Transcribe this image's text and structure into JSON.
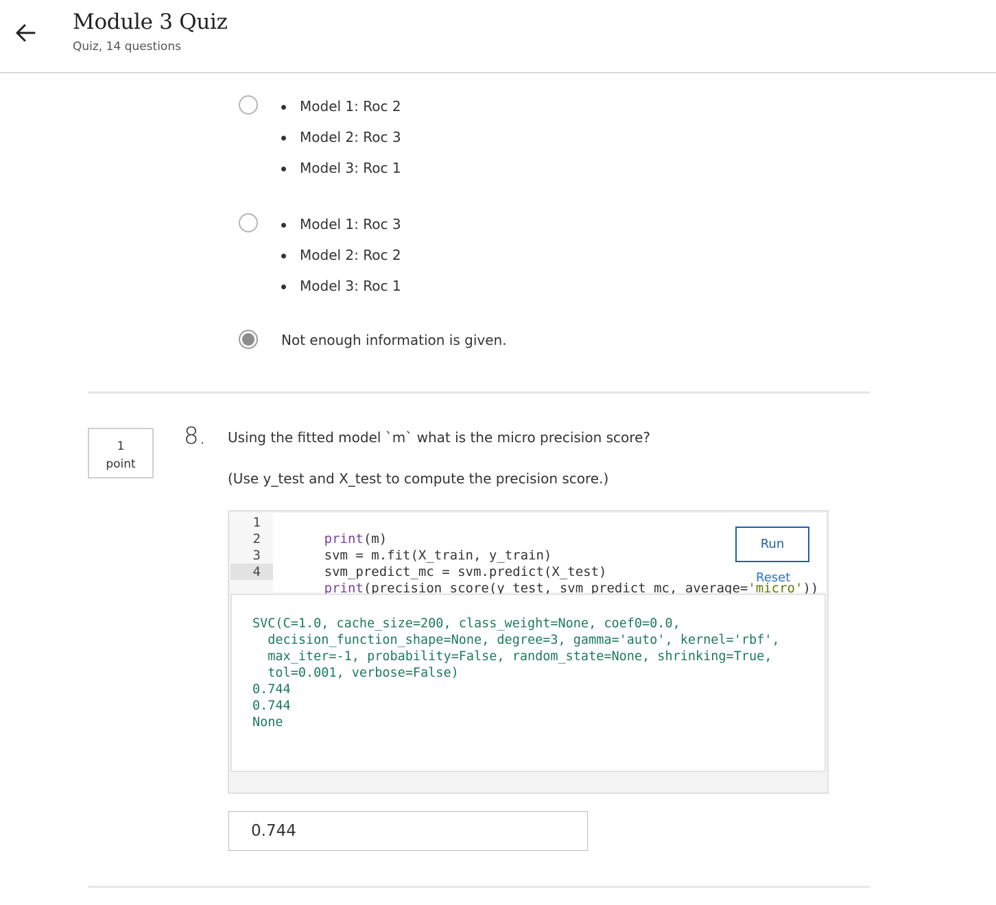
{
  "header": {
    "back_icon": "arrow-left-icon",
    "title": "Module 3 Quiz",
    "subtitle": "Quiz, 14 questions"
  },
  "previous_question": {
    "options": [
      {
        "items": [
          "Model 1: Roc 2",
          "Model 2: Roc 3",
          "Model 3: Roc 1"
        ],
        "selected": false
      },
      {
        "items": [
          "Model 1: Roc 3",
          "Model 2: Roc 2",
          "Model 3: Roc 1"
        ],
        "selected": false
      },
      {
        "text": "Not enough information is given.",
        "selected": true
      }
    ]
  },
  "question": {
    "points_value": "1",
    "points_label": "point",
    "number": "8.",
    "text": "Using the fitted model `m` what is the micro precision score?",
    "note": "(Use y_test and X_test to compute the precision score.)",
    "code": {
      "line_numbers": [
        "1",
        "2",
        "3",
        "4"
      ],
      "lines": [
        {
          "parts": [
            {
              "t": "print",
              "c": "kw"
            },
            {
              "t": "(m)"
            }
          ]
        },
        {
          "parts": [
            {
              "t": "svm = m.fit(X_train, y_train)"
            }
          ]
        },
        {
          "parts": [
            {
              "t": "svm_predict_mc = svm.predict(X_test)"
            }
          ]
        },
        {
          "parts": [
            {
              "t": "print",
              "c": "kw"
            },
            {
              "t": "(precision_score(y_test, svm_predict_mc, average="
            },
            {
              "t": "'micro'",
              "c": "str"
            },
            {
              "t": "))"
            }
          ]
        }
      ],
      "run_label": "Run",
      "reset_label": "Reset"
    },
    "output_lines": [
      "SVC(C=1.0, cache_size=200, class_weight=None, coef0=0.0,",
      "  decision_function_shape=None, degree=3, gamma='auto', kernel='rbf',",
      "  max_iter=-1, probability=False, random_state=None, shrinking=True,",
      "  tol=0.001, verbose=False)",
      "0.744",
      "0.744",
      "None"
    ],
    "answer_value": "0.744"
  },
  "colors": {
    "link": "#2a73cc",
    "button_border": "#1f5fad",
    "output_text": "#1d7a5f",
    "keyword": "#7a3e9d",
    "string": "#5c7a00"
  }
}
